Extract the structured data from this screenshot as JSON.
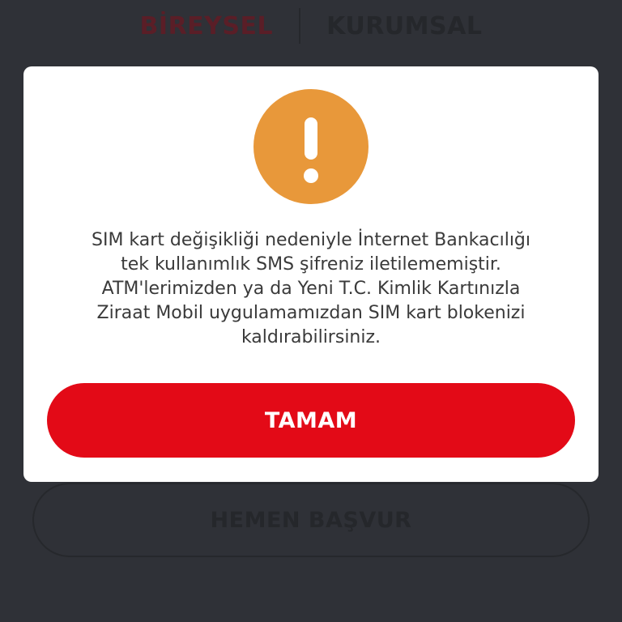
{
  "tabs": {
    "individual": "BİREYSEL",
    "corporate": "KURUMSAL"
  },
  "apply_button": {
    "label": "HEMEN BAŞVUR"
  },
  "dialog": {
    "icon": "exclamation-icon",
    "icon_color": "#e8983a",
    "message_lines": [
      "SIM kart değişikliği nedeniyle İnternet Bankacılığı",
      "tek kullanımlık SMS şifreniz iletilememiştir.",
      "ATM'lerimizden ya da Yeni T.C. Kimlik Kartınızla",
      "Ziraat Mobil uygulamamızdan SIM kart blokenizi",
      "kaldırabilirsiniz."
    ],
    "ok_label": "TAMAM",
    "ok_color": "#e30a17"
  }
}
